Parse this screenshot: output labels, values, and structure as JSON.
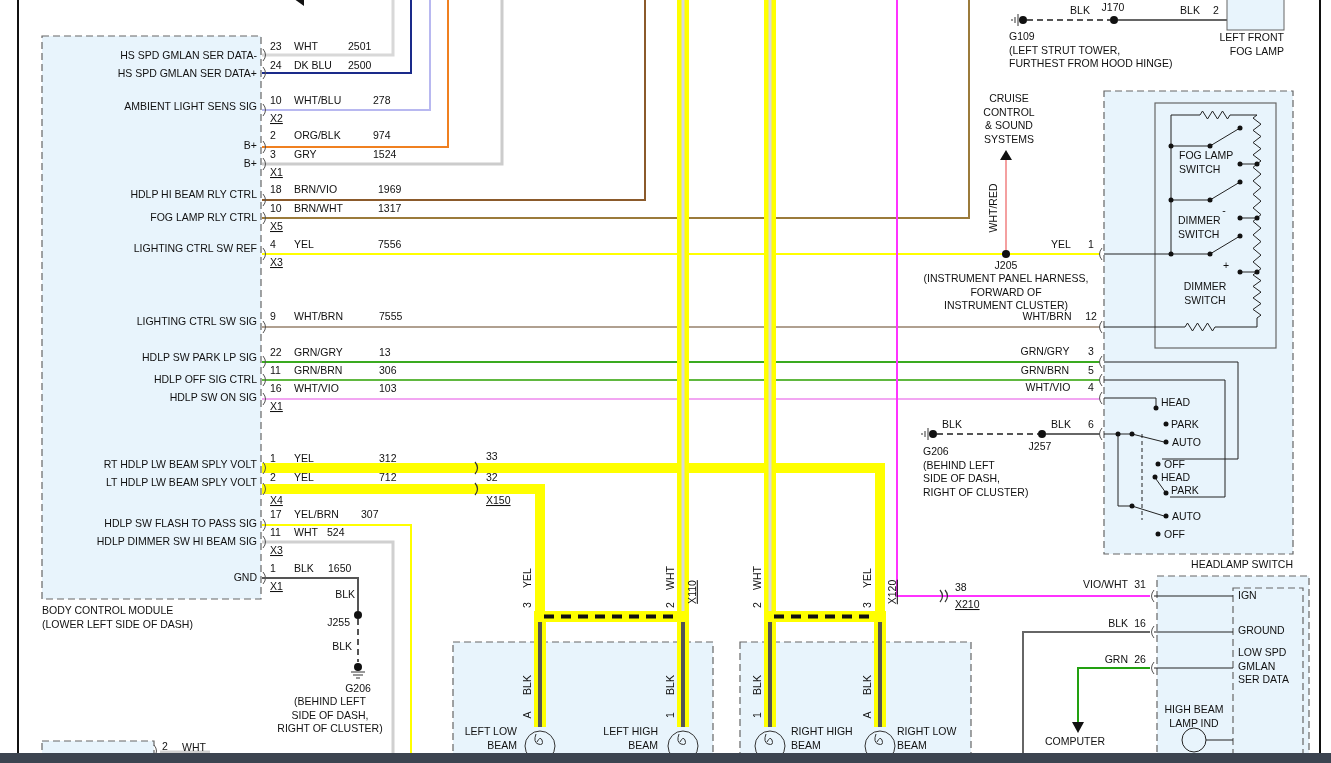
{
  "body_control_module": {
    "name": "BODY CONTROL MODULE",
    "location": "(LOWER LEFT SIDE OF DASH)",
    "pins": [
      {
        "signal": "HS SPD GMLAN SER DATA-",
        "pin": "23",
        "wire": "WHT",
        "circuit": "2501"
      },
      {
        "signal": "HS SPD GMLAN SER DATA+",
        "pin": "24",
        "wire": "DK BLU",
        "circuit": "2500"
      },
      {
        "signal": "AMBIENT LIGHT SENS SIG",
        "pin": "10",
        "wire": "WHT/BLU",
        "circuit": "278"
      },
      {
        "signal": "B+",
        "pin": "2",
        "wire": "ORG/BLK",
        "circuit": "974"
      },
      {
        "signal": "B+",
        "pin": "3",
        "wire": "GRY",
        "circuit": "1524"
      },
      {
        "signal": "HDLP HI BEAM RLY CTRL",
        "pin": "18",
        "wire": "BRN/VIO",
        "circuit": "1969"
      },
      {
        "signal": "FOG LAMP RLY CTRL",
        "pin": "10",
        "wire": "BRN/WHT",
        "circuit": "1317"
      },
      {
        "signal": "LIGHTING CTRL SW REF",
        "pin": "4",
        "wire": "YEL",
        "circuit": "7556"
      },
      {
        "signal": "LIGHTING CTRL SW SIG",
        "pin": "9",
        "wire": "WHT/BRN",
        "circuit": "7555"
      },
      {
        "signal": "HDLP SW PARK LP SIG",
        "pin": "22",
        "wire": "GRN/GRY",
        "circuit": "13"
      },
      {
        "signal": "HDLP OFF SIG CTRL",
        "pin": "11",
        "wire": "GRN/BRN",
        "circuit": "306"
      },
      {
        "signal": "HDLP SW ON SIG",
        "pin": "16",
        "wire": "WHT/VIO",
        "circuit": "103"
      },
      {
        "signal": "RT HDLP LW BEAM SPLY VOLT",
        "pin": "1",
        "wire": "YEL",
        "circuit": "312"
      },
      {
        "signal": "LT HDLP LW BEAM SPLY VOLT",
        "pin": "2",
        "wire": "YEL",
        "circuit": "712"
      },
      {
        "signal": "HDLP SW FLASH TO PASS SIG",
        "pin": "17",
        "wire": "YEL/BRN",
        "circuit": "307"
      },
      {
        "signal": "HDLP DIMMER SW HI BEAM SIG",
        "pin": "11",
        "wire": "WHT",
        "circuit": "524"
      },
      {
        "signal": "GND",
        "pin": "1",
        "wire": "BLK",
        "circuit": "1650"
      }
    ],
    "connectors": [
      "X2",
      "X1",
      "X5",
      "X3",
      "X1",
      "X4",
      "X3",
      "X1"
    ]
  },
  "bcm_ground": {
    "wire_upper": "BLK",
    "splice": "J255",
    "wire_lower": "BLK",
    "ground": "G206",
    "location": [
      "(BEHIND LEFT",
      "SIDE OF DASH,",
      "RIGHT OF CLUSTER)"
    ]
  },
  "x150": {
    "pins": [
      "33",
      "32"
    ],
    "name": "X150"
  },
  "headlamps": [
    {
      "name": [
        "LEFT LOW",
        "BEAM"
      ],
      "feed_wire": "YEL",
      "feed_pin": "3",
      "ground_wire": "BLK",
      "ground_pin": "A"
    },
    {
      "name": [
        "LEFT HIGH",
        "BEAM"
      ],
      "feed_wire": "WHT",
      "feed_pin": "2",
      "ground_wire": "BLK",
      "ground_pin": "1"
    },
    {
      "name": [
        "RIGHT HIGH",
        "BEAM"
      ],
      "feed_wire": "WHT",
      "feed_pin": "2",
      "ground_wire": "BLK",
      "ground_pin": "1"
    },
    {
      "name": [
        "RIGHT LOW",
        "BEAM"
      ],
      "feed_wire": "YEL",
      "feed_pin": "3",
      "ground_wire": "BLK",
      "ground_pin": "A"
    }
  ],
  "headlamp_connectors": [
    "X110",
    "X120"
  ],
  "fog_lamp": {
    "ground": "G109",
    "ground_location": [
      "(LEFT STRUT TOWER,",
      "FURTHEST FROM HOOD HINGE)"
    ],
    "wire_ground": "BLK",
    "splice": "J170",
    "wire_lamp": "BLK",
    "pin": "2",
    "name": [
      "LEFT FRONT",
      "FOG LAMP"
    ]
  },
  "cruise": {
    "destination": [
      "CRUISE",
      "CONTROL",
      "& SOUND",
      "SYSTEMS"
    ],
    "wire": "WHT/RED",
    "splice": "J205",
    "location": [
      "(INSTRUMENT PANEL HARNESS,",
      "FORWARD OF",
      "INSTRUMENT CLUSTER)"
    ]
  },
  "headlamp_switch": {
    "name": "HEADLAMP SWITCH",
    "pins": [
      {
        "wire": "YEL",
        "pin": "1"
      },
      {
        "wire": "WHT/BRN",
        "pin": "12"
      },
      {
        "wire": "GRN/GRY",
        "pin": "3"
      },
      {
        "wire": "GRN/BRN",
        "pin": "5"
      },
      {
        "wire": "WHT/VIO",
        "pin": "4"
      },
      {
        "wire": "BLK",
        "pin": "6"
      }
    ],
    "inner_labels": [
      [
        "FOG LAMP",
        "SWITCH"
      ],
      [
        "DIMMER",
        "SWITCH"
      ],
      [
        "DIMMER",
        "SWITCH"
      ]
    ],
    "signs": [
      "-",
      "+"
    ],
    "positions": [
      "HEAD",
      "PARK",
      "AUTO",
      "OFF",
      "HEAD",
      "PARK",
      "AUTO",
      "OFF"
    ],
    "ground": {
      "wire_ground": "BLK",
      "splice": "J257",
      "ground": "G206",
      "location": [
        "(BEHIND LEFT",
        "SIDE OF DASH,",
        "RIGHT OF CLUSTER)"
      ]
    }
  },
  "x210": {
    "pin": "38",
    "name": "X210"
  },
  "instrument_cluster": {
    "pins": [
      {
        "wire": "VIO/WHT",
        "pin": "31"
      },
      {
        "wire": "BLK",
        "pin": "16"
      },
      {
        "wire": "GRN",
        "pin": "26"
      }
    ],
    "labels": [
      [
        "IGN"
      ],
      [
        "GROUND"
      ],
      [
        "LOW SPD",
        "GMLAN",
        "SER DATA"
      ]
    ],
    "indicator": [
      "HIGH BEAM",
      "LAMP IND"
    ],
    "destination": "COMPUTER"
  },
  "partial_module": {
    "pin": "2",
    "wire": "WHT"
  }
}
